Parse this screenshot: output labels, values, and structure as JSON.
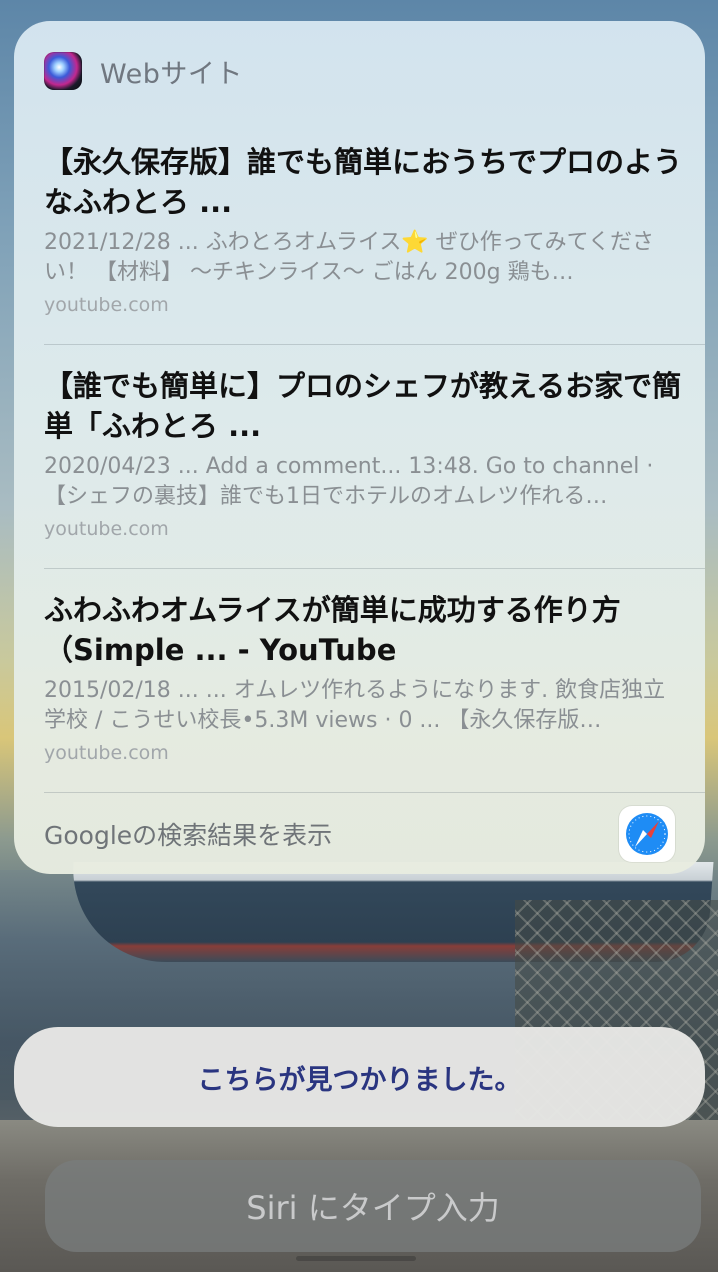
{
  "section": {
    "title": "Webサイト"
  },
  "results": [
    {
      "title": "【永久保存版】誰でも簡単におうちでプロのようなふわとろ ...",
      "snippet": "2021/12/28 ... ふわとろオムライス⭐️ ぜひ作ってみてください！ 【材料】 〜チキンライス〜 ごはん 200g 鶏も…",
      "source": "youtube.com"
    },
    {
      "title": "【誰でも簡単に】プロのシェフが教えるお家で簡単「ふわとろ ...",
      "snippet": "2020/04/23 ... Add a comment... 13:48. Go to channel · 【シェフの裏技】誰でも1日でホテルのオムレツ作れる…",
      "source": "youtube.com"
    },
    {
      "title": "ふわふわオムライスが簡単に成功する作り方（Simple ... - YouTube",
      "snippet": "2015/02/18 ... ... オムレツ作れるようになります. 飲食店独立学校 / こうせい校長•5.3M views · 0 ... 【永久保存版…",
      "source": "youtube.com"
    }
  ],
  "google": {
    "label": "Googleの検索結果を表示",
    "icon": "safari-icon"
  },
  "response": {
    "text": "こちらが見つかりました。"
  },
  "type_to_siri": {
    "label": "Siri にタイプ入力"
  },
  "colors": {
    "accent": "#2a3580",
    "compass_blue": "#1e8cf5",
    "compass_red": "#e8403a"
  }
}
